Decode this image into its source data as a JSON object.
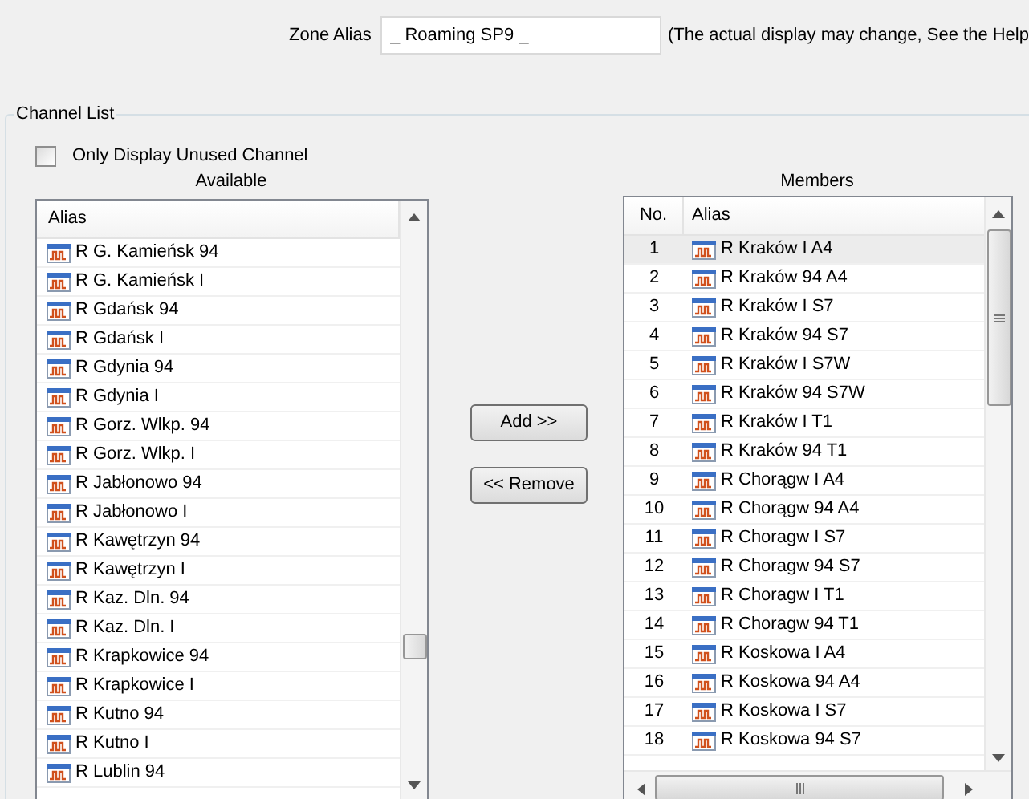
{
  "zone_alias": {
    "label": "Zone Alias",
    "value": "_ Roaming SP9 _",
    "note": "(The actual display may change, See the Help"
  },
  "channel_list": {
    "title": "Channel List",
    "only_unused": {
      "label": "Only Display Unused Channel",
      "checked": false
    },
    "available": {
      "title": "Available",
      "columns": [
        "Alias"
      ],
      "rows": [
        {
          "alias": "R G. Kamieńsk 94"
        },
        {
          "alias": "R G. Kamieńsk I"
        },
        {
          "alias": "R Gdańsk 94"
        },
        {
          "alias": "R Gdańsk I"
        },
        {
          "alias": "R Gdynia 94"
        },
        {
          "alias": "R Gdynia I"
        },
        {
          "alias": "R Gorz. Wlkp. 94"
        },
        {
          "alias": "R Gorz. Wlkp. I"
        },
        {
          "alias": "R Jabłonowo 94"
        },
        {
          "alias": "R Jabłonowo I"
        },
        {
          "alias": "R Kawętrzyn 94"
        },
        {
          "alias": "R Kawętrzyn I"
        },
        {
          "alias": "R Kaz. Dln. 94"
        },
        {
          "alias": "R Kaz. Dln. I"
        },
        {
          "alias": "R Krapkowice 94"
        },
        {
          "alias": "R Krapkowice I"
        },
        {
          "alias": "R Kutno 94"
        },
        {
          "alias": "R Kutno I"
        },
        {
          "alias": "R Lublin 94"
        }
      ]
    },
    "buttons": [
      {
        "label": "Add >>"
      },
      {
        "label": "<< Remove"
      }
    ],
    "members": {
      "title": "Members",
      "columns": [
        "No.",
        "Alias"
      ],
      "rows": [
        {
          "no": "1",
          "alias": "R Kraków I A4",
          "selected": true
        },
        {
          "no": "2",
          "alias": "R Kraków 94 A4",
          "selected": false
        },
        {
          "no": "3",
          "alias": "R Kraków I S7",
          "selected": false
        },
        {
          "no": "4",
          "alias": "R Kraków 94 S7",
          "selected": false
        },
        {
          "no": "5",
          "alias": "R Kraków I S7W",
          "selected": false
        },
        {
          "no": "6",
          "alias": "R Kraków 94 S7W",
          "selected": false
        },
        {
          "no": "7",
          "alias": "R Kraków I T1",
          "selected": false
        },
        {
          "no": "8",
          "alias": "R Kraków 94 T1",
          "selected": false
        },
        {
          "no": "9",
          "alias": "R Chorągw I A4",
          "selected": false
        },
        {
          "no": "10",
          "alias": "R Chorągw 94 A4",
          "selected": false
        },
        {
          "no": "11",
          "alias": "R Choragw I S7",
          "selected": false
        },
        {
          "no": "12",
          "alias": "R Choragw 94 S7",
          "selected": false
        },
        {
          "no": "13",
          "alias": "R Choragw I T1",
          "selected": false
        },
        {
          "no": "14",
          "alias": "R Choragw 94 T1",
          "selected": false
        },
        {
          "no": "15",
          "alias": "R Koskowa I A4",
          "selected": false
        },
        {
          "no": "16",
          "alias": "R Koskowa 94 A4",
          "selected": false
        },
        {
          "no": "17",
          "alias": "R Koskowa I S7",
          "selected": false
        },
        {
          "no": "18",
          "alias": "R Koskowa 94 S7",
          "selected": false
        }
      ]
    }
  }
}
